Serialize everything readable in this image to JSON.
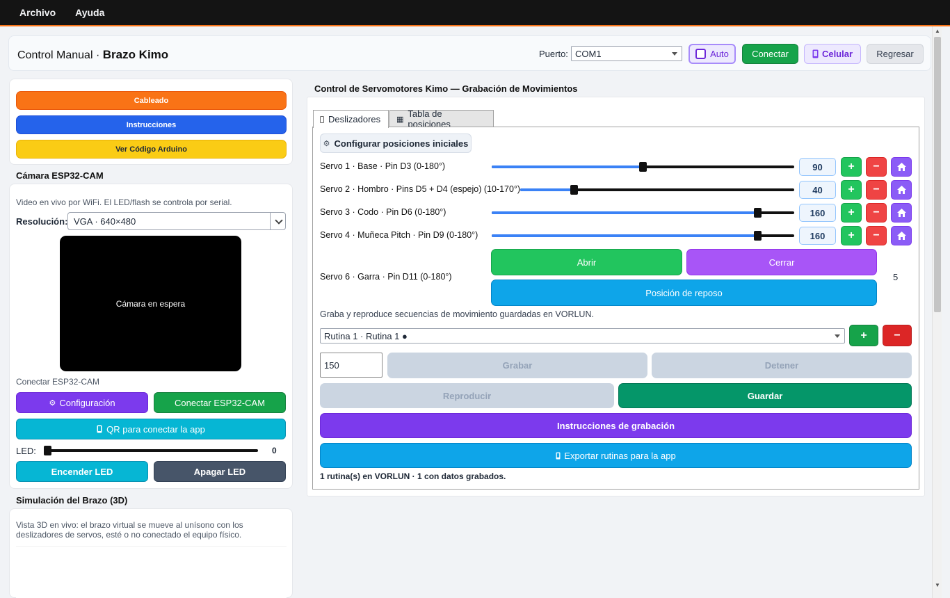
{
  "menu": {
    "items": [
      "Archivo",
      "Ayuda"
    ]
  },
  "header": {
    "title_prefix": "Control Manual · ",
    "title_strong": "Brazo Kimo",
    "port_label": "Puerto:",
    "port_value": "COM1",
    "auto_label": "Auto",
    "connect_label": "Conectar",
    "cell_label": "Celular",
    "back_label": "Regresar"
  },
  "links": {
    "wiring": "Cableado",
    "instructions": "Instrucciones",
    "arduino_code": "Ver Código Arduino"
  },
  "camera": {
    "title": "Cámara ESP32-CAM",
    "desc": "Video en vivo por WiFi. El LED/flash se controla por serial.",
    "resolution_label": "Resolución:",
    "resolution_value": "VGA · 640×480",
    "status": "Cámara en espera",
    "connect_hint": "Conectar ESP32-CAM",
    "config_label": "Configuración",
    "connect_label": "Conectar ESP32-CAM",
    "qr_label": "QR para conectar la app",
    "led_label": "LED:",
    "led_value": "0",
    "led_on": "Encender LED",
    "led_off": "Apagar LED"
  },
  "simulation": {
    "title": "Simulación del Brazo (3D)",
    "desc": "Vista 3D en vivo: el brazo virtual se mueve al unísono con los deslizadores de servos, esté o no conectado el equipo físico."
  },
  "control": {
    "title": "Control de Servomotores Kimo — Grabación de Movimientos",
    "tabs": [
      "Deslizadores",
      "Tabla de posiciones"
    ],
    "config_initial": "Configurar posiciones iniciales",
    "servos": [
      {
        "label": "Servo 1 · Base · Pin D3 (0-180°)",
        "value": "90",
        "min": 0,
        "max": 180
      },
      {
        "label": "Servo 2 · Hombro · Pins D5 + D4 (espejo) (10-170°)",
        "value": "40",
        "min": 10,
        "max": 170
      },
      {
        "label": "Servo 3 · Codo · Pin D6 (0-180°)",
        "value": "160",
        "min": 0,
        "max": 180
      },
      {
        "label": "Servo 4 · Muñeca Pitch · Pin D9 (0-180°)",
        "value": "160",
        "min": 0,
        "max": 180
      }
    ],
    "gripper": {
      "label": "Servo 6 · Garra · Pin D11 (0-180°)",
      "open": "Abrir",
      "close": "Cerrar",
      "rest": "Posición de reposo",
      "value": "5"
    },
    "recording": {
      "desc": "Graba y reproduce secuencias de movimiento guardadas en VORLUN.",
      "routine_value": "Rutina 1 · Rutina 1 ●",
      "interval_value": "150",
      "record": "Grabar",
      "stop": "Detener",
      "play": "Reproducir",
      "save": "Guardar",
      "instructions": "Instrucciones de grabación",
      "export": "Exportar rutinas para la app",
      "status": "1 rutina(s) en VORLUN · 1 con datos grabados."
    }
  },
  "colors": {
    "orange": "#f97316",
    "blue": "#2563eb",
    "yellow": "#facc15",
    "purple": "#7c3aed",
    "green": "#16a34a",
    "cyan": "#06b6d4",
    "slate": "#475569"
  }
}
